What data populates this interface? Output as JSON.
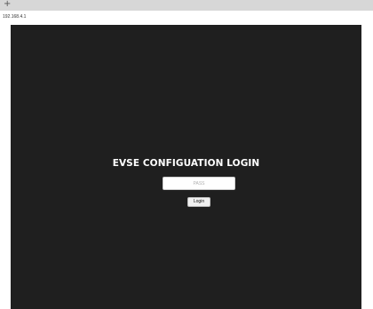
{
  "browser": {
    "new_tab_symbol": "+",
    "url": "192.168.4.1"
  },
  "page": {
    "title": "EVSE CONFIGUATION LOGIN",
    "password_placeholder": "PASS",
    "password_value": "",
    "login_label": "Login"
  },
  "colors": {
    "background": "#1f1f1f",
    "title": "#ffffff",
    "input_background": "#ffffff",
    "button_background": "#f0f0f0"
  }
}
